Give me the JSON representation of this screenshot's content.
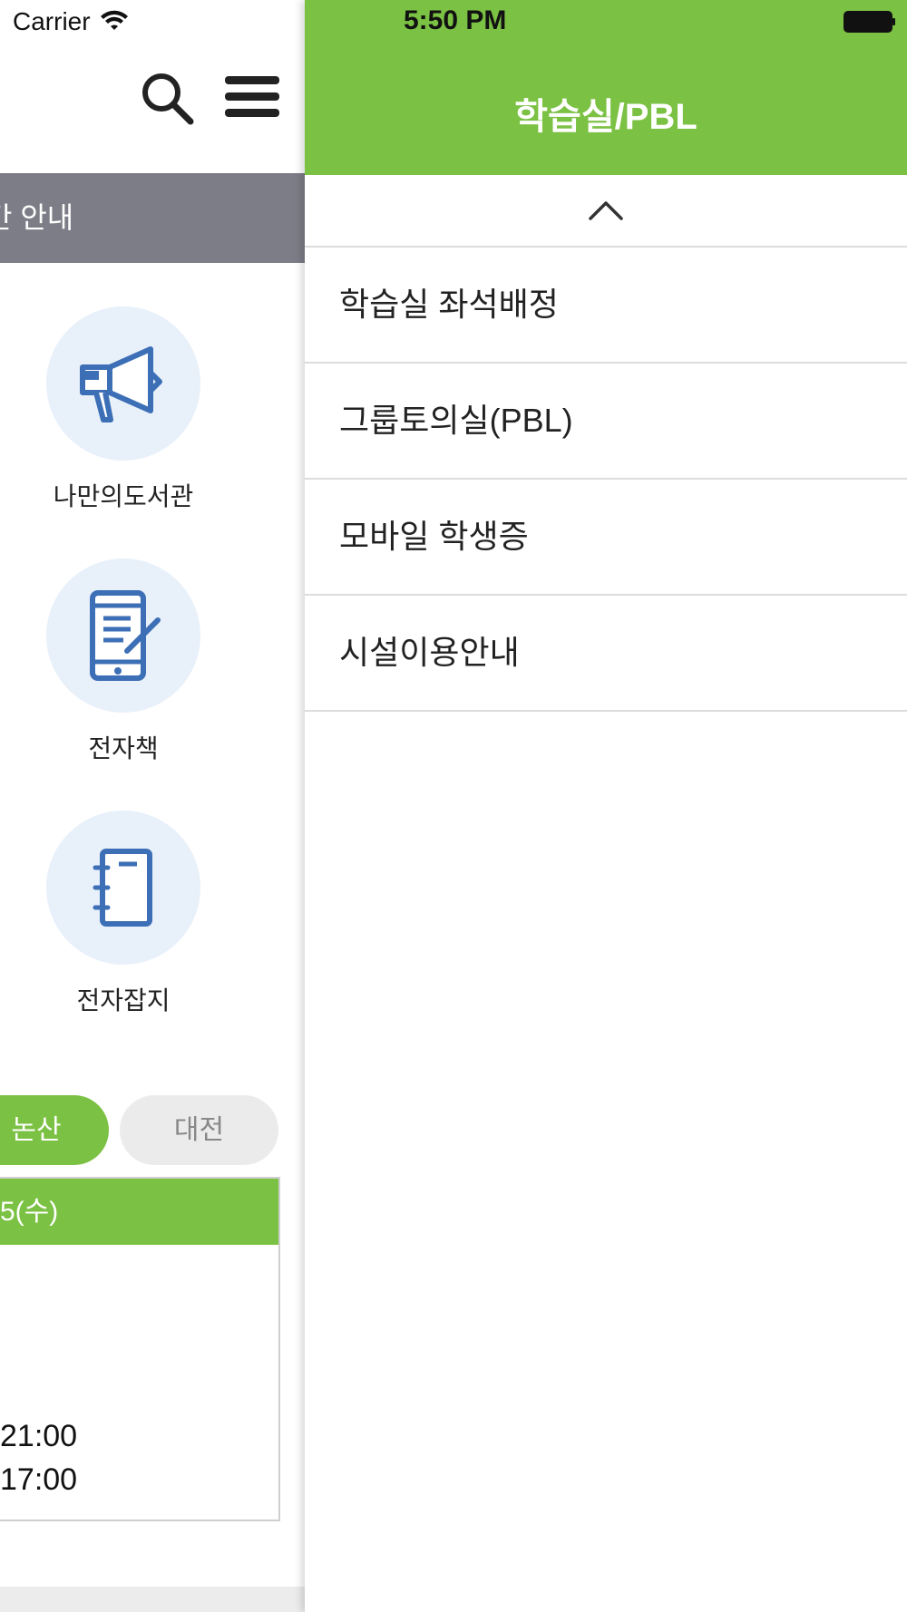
{
  "status_bar": {
    "carrier": "Carrier",
    "time": "5:50 PM"
  },
  "left_page": {
    "notice_bar": "간 안내",
    "quick_links": [
      {
        "label": "나만의도서관",
        "icon": "megaphone-icon"
      },
      {
        "label": "전자책",
        "icon": "ebook-tablet-icon"
      },
      {
        "label": "전자잡지",
        "icon": "notebook-icon"
      }
    ],
    "campus_tabs": {
      "active": "논산",
      "inactive": "대전"
    },
    "hours": {
      "date_header": "5(수)",
      "line1": "21:00",
      "line2": "17:00"
    }
  },
  "drawer": {
    "title": "학습실/PBL",
    "items": [
      "학습실 좌석배정",
      "그룹토의실(PBL)",
      "모바일 학생증",
      "시설이용안내"
    ]
  },
  "colors": {
    "accent_green": "#7bc143",
    "notice_gray": "#7d7d87",
    "icon_blue": "#3d6fb6",
    "icon_circle": "#e8f0fa"
  }
}
